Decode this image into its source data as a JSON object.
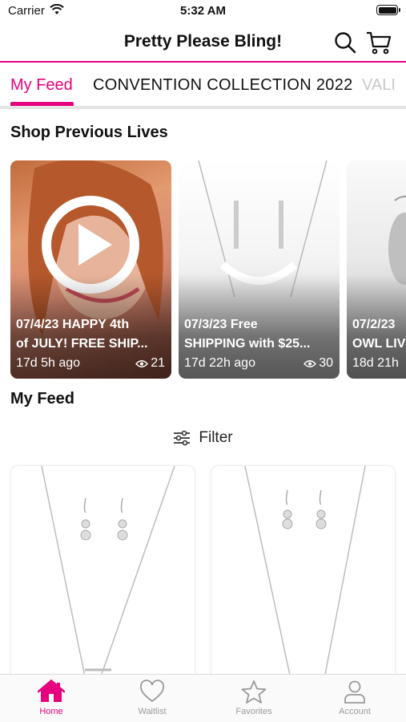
{
  "status_bar": {
    "carrier": "Carrier",
    "time": "5:32 AM"
  },
  "nav": {
    "title": "Pretty Please Bling!",
    "search_icon": "search-icon",
    "cart_icon": "cart-icon"
  },
  "tabs": [
    {
      "label": "My Feed",
      "active": true
    },
    {
      "label": "CONVENTION COLLECTION 2022",
      "active": false
    },
    {
      "label": "VALI",
      "active": false
    }
  ],
  "sections": {
    "previous_lives": "Shop Previous Lives",
    "my_feed": "My Feed"
  },
  "lives": [
    {
      "line1": "07/4/23 HAPPY 4th",
      "line2": "of JULY! FREE SHIP...",
      "age": "17d 5h ago",
      "views": "21"
    },
    {
      "line1": "07/3/23 Free",
      "line2": "SHIPPING with $25...",
      "age": "17d 22h ago",
      "views": "30"
    },
    {
      "line1": "07/2/23",
      "line2": "OWL LIV",
      "age": "18d 21h",
      "views": ""
    }
  ],
  "filter": {
    "label": "Filter"
  },
  "tab_bar": [
    {
      "label": "Home",
      "icon": "home-icon",
      "active": true
    },
    {
      "label": "Waitlist",
      "icon": "heart-icon",
      "active": false
    },
    {
      "label": "Favorites",
      "icon": "star-icon",
      "active": false
    },
    {
      "label": "Account",
      "icon": "person-icon",
      "active": false
    }
  ],
  "colors": {
    "accent": "#e6007e",
    "inactive": "#9a9a9a"
  }
}
